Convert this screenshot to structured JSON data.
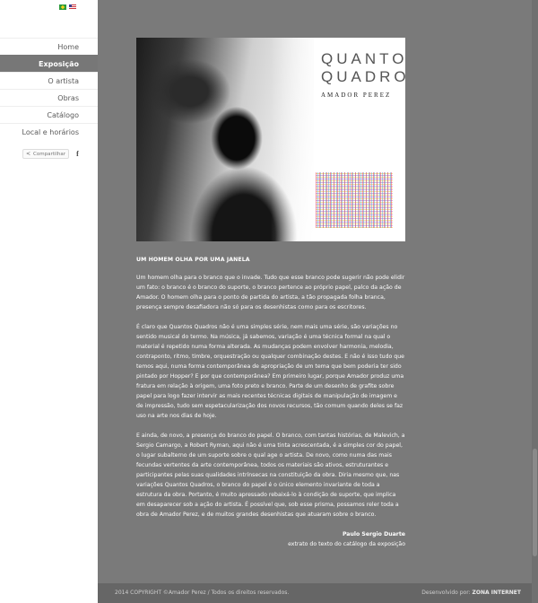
{
  "languages": [
    {
      "code": "pt-br",
      "icon": "brazil-flag-icon"
    },
    {
      "code": "en-us",
      "icon": "usa-flag-icon"
    }
  ],
  "nav": {
    "items": [
      {
        "label": "Home"
      },
      {
        "label": "Exposição",
        "active": true
      },
      {
        "label": "O artista"
      },
      {
        "label": "Obras"
      },
      {
        "label": "Catálogo"
      },
      {
        "label": "Local e horários"
      }
    ]
  },
  "share": {
    "label": "Compartilhar",
    "facebook_icon": "f"
  },
  "cover": {
    "title_line1": "QUANTOS",
    "title_line2": "QUADROS",
    "subtitle": "AMADOR PEREZ"
  },
  "article": {
    "heading": "UM HOMEM OLHA POR UMA JANELA",
    "paragraphs": [
      "Um homem olha para o branco que o invade. Tudo que esse branco pode sugerir não pode elidir um fato: o branco é o branco do suporte, o branco pertence ao próprio papel, palco da ação de Amador. O homem olha para o ponto de partida do artista, a tão propagada folha branca, presença sempre desafiadora não só para os desenhistas como para os escritores.",
      "É claro que Quantos Quadros não é uma simples série, nem mais uma série, são variações no sentido musical do termo. Na música, já sabemos, variação é uma técnica formal na qual o material é repetido numa forma alterada. As mudanças podem envolver harmonia, melodia, contraponto, ritmo, timbre, orquestração ou qualquer combinação destes. E não é isso tudo que temos aqui, numa forma contemporânea de apropriação de um tema que bem poderia ter sido pintado por Hopper? E por que contemporânea? Em primeiro lugar, porque Amador produz uma fratura em relação à origem, uma foto preto e branco. Parte de um desenho de grafite sobre papel para logo fazer intervir as mais recentes técnicas digitais de manipulação de imagem e de impressão, tudo sem espetacularização dos novos recursos, tão comum quando deles se faz uso na arte nos dias de hoje.",
      "E ainda, de novo, a presença do branco do papel. O branco, com tantas histórias, de Malevich, a Sergio Camargo, a Robert Ryman, aqui não é uma tinta acrescentada, é a simples cor do papel, o lugar subalterno de um suporte sobre o qual age o artista. De novo, como numa das mais fecundas vertentes da arte contemporânea, todos os materiais são ativos, estruturantes e participantes pelas suas qualidades intrínsecas na constituição da obra. Diria mesmo que, nas variações Quantos Quadros, o branco do papel é o único elemento invariante de toda a estrutura da obra. Portanto, é muito apressado rebaixá-lo à condição de suporte, que implica em desaparecer sob a ação do artista. É possível que, sob esse prisma, possamos reler toda a obra de Amador Perez, e de muitos grandes desenhistas que atuaram sobre o branco."
    ],
    "author": "Paulo Sergio Duarte",
    "source": "extrato do texto do catálogo da exposição"
  },
  "footer": {
    "copyright": "2014 COPYRIGHT ©Amador Perez / Todos os direitos reservados.",
    "developed_by_label": "Desenvolvido por:",
    "developer": "ZONA INTERNET"
  }
}
